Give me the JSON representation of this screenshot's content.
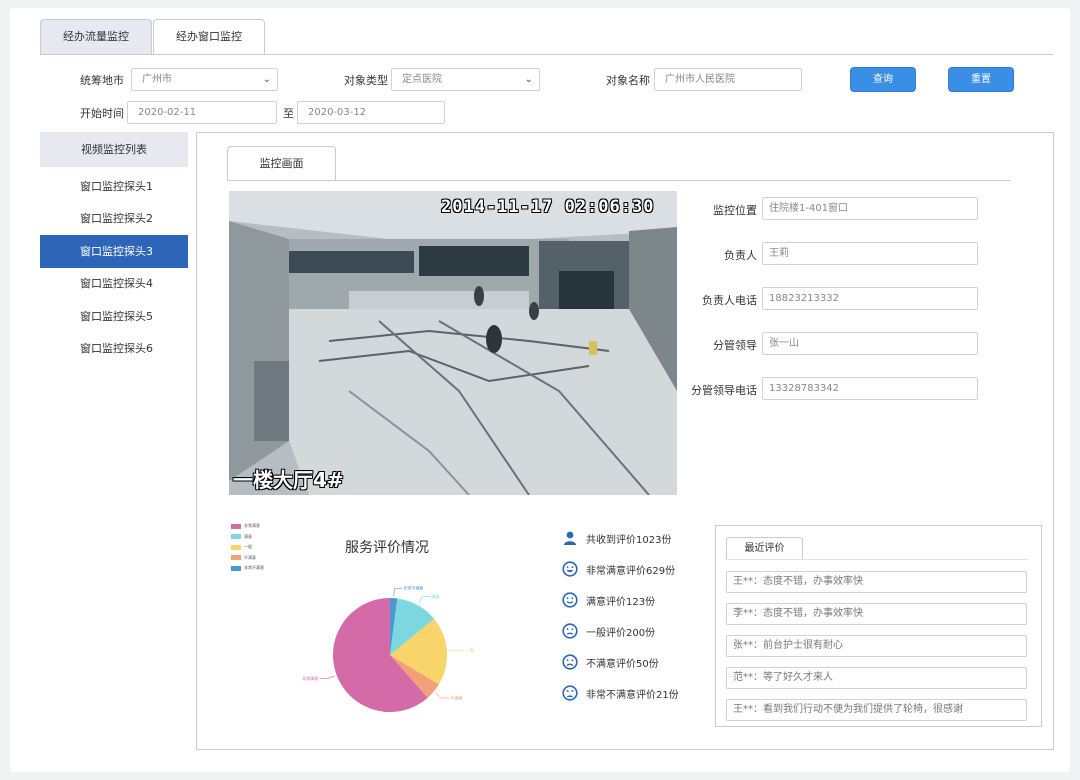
{
  "tabs": {
    "flow": "经办流量监控",
    "window": "经办窗口监控"
  },
  "filters": {
    "city_label": "统筹地市",
    "city_value": "广州市",
    "type_label": "对象类型",
    "type_value": "定点医院",
    "name_label": "对象名称",
    "name_value": "广州市人民医院",
    "query_btn": "查询",
    "reset_btn": "重置",
    "start_label": "开始时间",
    "start_value": "2020-02-11",
    "to_label": "至",
    "end_value": "2020-03-12"
  },
  "sidebar": {
    "title": "视频监控列表",
    "items": [
      "窗口监控探头1",
      "窗口监控探头2",
      "窗口监控探头3",
      "窗口监控探头4",
      "窗口监控探头5",
      "窗口监控探头6"
    ],
    "selected_index": 2
  },
  "monitor": {
    "tab": "监控画面",
    "timestamp": "2014-11-17 02:06:30",
    "caption": "一楼大厅4#"
  },
  "info": {
    "location_label": "监控位置",
    "location_value": "住院楼1-401窗口",
    "owner_label": "负责人",
    "owner_value": "王莉",
    "owner_phone_label": "负责人电话",
    "owner_phone_value": "18823213332",
    "leader_label": "分管领导",
    "leader_value": "张一山",
    "leader_phone_label": "分管领导电话",
    "leader_phone_value": "13328783342"
  },
  "stats": {
    "total": "共收到评价1023份",
    "very_satisfied": "非常满意评价629份",
    "satisfied": "满意评价123份",
    "average": "一般评价200份",
    "unsatisfied": "不满意评价50份",
    "very_unsatisfied": "非常不满意评价21份"
  },
  "reviews": {
    "title": "最近评价",
    "items": [
      "王**：态度不错，办事效率快",
      "李**：态度不错，办事效率快",
      "张**：前台护士很有耐心",
      "范**：等了好久才来人",
      "王**：看到我们行动不便为我们提供了轮椅，很感谢"
    ]
  },
  "chart_data": {
    "type": "pie",
    "title": "服务评价情况",
    "series": [
      {
        "name": "非常满意",
        "value": 629,
        "color": "#d46aa8"
      },
      {
        "name": "满意",
        "value": 123,
        "color": "#7dd7df"
      },
      {
        "name": "一般",
        "value": 200,
        "color": "#f7d56b"
      },
      {
        "name": "不满意",
        "value": 50,
        "color": "#f2a07a"
      },
      {
        "name": "非常不满意",
        "value": 21,
        "color": "#4a97d4"
      }
    ],
    "legend_position": "top-left",
    "colors": {
      "accent": "#3a8ee6",
      "selected": "#2e66b7",
      "icon": "#2e66b7"
    }
  }
}
